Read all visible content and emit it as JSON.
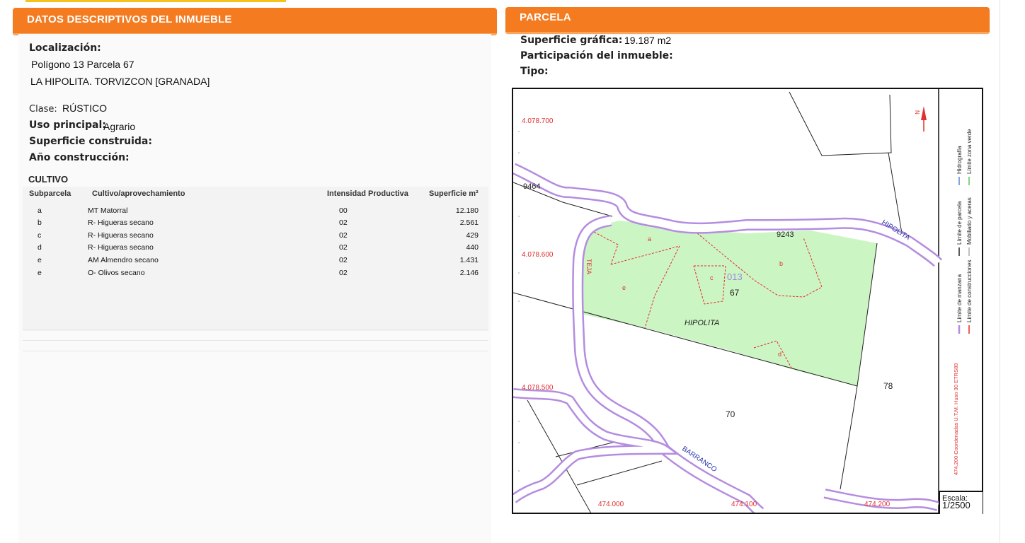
{
  "left": {
    "header": "DATOS DESCRIPTIVOS DEL INMUEBLE",
    "localizacion_label": "Localización:",
    "localizacion_line1": "Polígono 13 Parcela 67",
    "localizacion_line2": "LA HIPOLITA. TORVIZCON [GRANADA]",
    "clase_label": "Clase:",
    "clase_value": "RÚSTICO",
    "uso_label": "Uso principal:",
    "uso_value": "Agrario",
    "superficie_label": "Superficie construida:",
    "anio_label": "Año construcción:",
    "cultivo_title": "CULTIVO",
    "table_headers": [
      "Subparcela",
      "Cultivo/aprovechamiento",
      "Intensidad Productiva",
      "Superficie m²"
    ],
    "rows": [
      {
        "sub": "a",
        "cultivo": "MT Matorral",
        "intensidad": "00",
        "superficie": "12.180"
      },
      {
        "sub": "b",
        "cultivo": "R- Higueras secano",
        "intensidad": "02",
        "superficie": "2.561"
      },
      {
        "sub": "c",
        "cultivo": "R- Higueras secano",
        "intensidad": "02",
        "superficie": "429"
      },
      {
        "sub": "d",
        "cultivo": "R- Higueras secano",
        "intensidad": "02",
        "superficie": "440"
      },
      {
        "sub": "e",
        "cultivo": "AM Almendro secano",
        "intensidad": "02",
        "superficie": "1.431"
      },
      {
        "sub": "e",
        "cultivo": "O- Olivos secano",
        "intensidad": "02",
        "superficie": "2.146"
      }
    ]
  },
  "right": {
    "header": "PARCELA",
    "superficie_grafica_label": "Superficie gráfica:",
    "superficie_grafica_value": "19.187 m2",
    "participacion_label": "Participación del inmueble:",
    "tipo_label": "Tipo:"
  },
  "map": {
    "y_labels": [
      "4.078.700",
      "4.078.600",
      "4.078.500"
    ],
    "x_labels": [
      "474.000",
      "474.100",
      "474.200"
    ],
    "parcel_numbers": [
      "9464",
      "9243",
      "67",
      "78",
      "70"
    ],
    "poligono": "013",
    "place_labels": [
      "HIPOLITA",
      "HIPOLITA",
      "BARRANCO",
      "TEJA"
    ],
    "subparcel_labels": [
      "a",
      "b",
      "c",
      "d",
      "e"
    ],
    "legend": [
      "Límite de manzana",
      "Límite de parcela",
      "Hidrografía",
      "Límite de construcciones",
      "Mobiliario y aceras",
      "Límite zona verde"
    ],
    "crs": "474.200 Coordenadas U.T.M. Huso 30 ETRS89",
    "scale_label": "Escala:",
    "scale_value": "1/2500",
    "colors": {
      "parcel_fill": "#ccf5c4",
      "road": "#b48ce0",
      "constructions": "#e8262a"
    }
  }
}
